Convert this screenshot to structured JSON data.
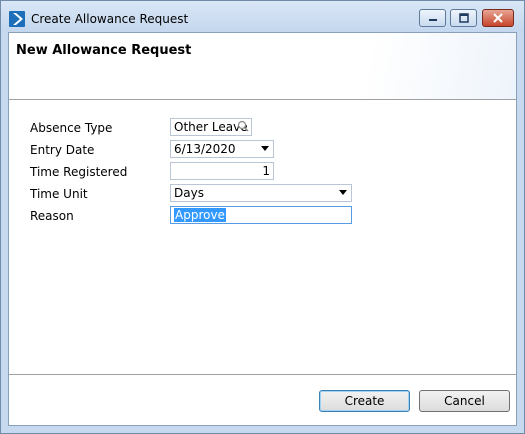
{
  "window": {
    "title": "Create Allowance Request"
  },
  "header": {
    "title": "New Allowance Request"
  },
  "form": {
    "absence_type": {
      "label": "Absence Type",
      "value": "Other Leave"
    },
    "entry_date": {
      "label": "Entry Date",
      "value": "6/13/2020"
    },
    "time_registered": {
      "label": "Time Registered",
      "value": "1"
    },
    "time_unit": {
      "label": "Time Unit",
      "value": "Days"
    },
    "reason": {
      "label": "Reason",
      "value": "Approve"
    }
  },
  "buttons": {
    "create": "Create",
    "cancel": "Cancel"
  },
  "colors": {
    "selection": "#3399ff",
    "frame": "#c6d9ee",
    "close_button": "#c7442c"
  },
  "icons": {
    "app": "app-logo-icon",
    "lookup": "search-icon",
    "dropdown": "chevron-down-icon"
  }
}
